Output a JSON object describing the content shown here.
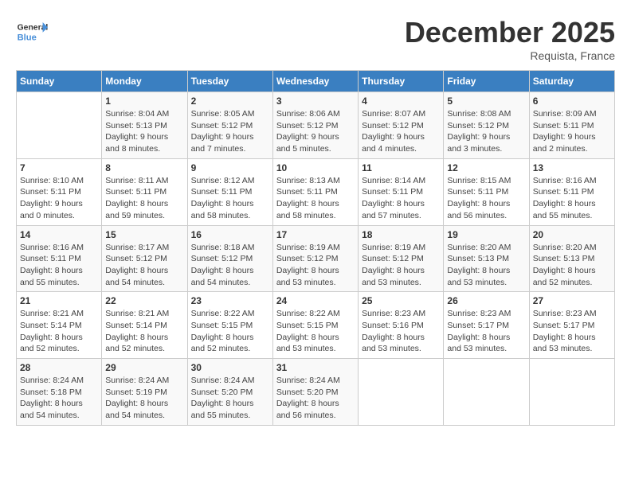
{
  "header": {
    "logo_general": "General",
    "logo_blue": "Blue",
    "month": "December 2025",
    "location": "Requista, France"
  },
  "days_of_week": [
    "Sunday",
    "Monday",
    "Tuesday",
    "Wednesday",
    "Thursday",
    "Friday",
    "Saturday"
  ],
  "weeks": [
    [
      {
        "day": "",
        "info": ""
      },
      {
        "day": "1",
        "info": "Sunrise: 8:04 AM\nSunset: 5:13 PM\nDaylight: 9 hours\nand 8 minutes."
      },
      {
        "day": "2",
        "info": "Sunrise: 8:05 AM\nSunset: 5:12 PM\nDaylight: 9 hours\nand 7 minutes."
      },
      {
        "day": "3",
        "info": "Sunrise: 8:06 AM\nSunset: 5:12 PM\nDaylight: 9 hours\nand 5 minutes."
      },
      {
        "day": "4",
        "info": "Sunrise: 8:07 AM\nSunset: 5:12 PM\nDaylight: 9 hours\nand 4 minutes."
      },
      {
        "day": "5",
        "info": "Sunrise: 8:08 AM\nSunset: 5:12 PM\nDaylight: 9 hours\nand 3 minutes."
      },
      {
        "day": "6",
        "info": "Sunrise: 8:09 AM\nSunset: 5:11 PM\nDaylight: 9 hours\nand 2 minutes."
      }
    ],
    [
      {
        "day": "7",
        "info": "Sunrise: 8:10 AM\nSunset: 5:11 PM\nDaylight: 9 hours\nand 0 minutes."
      },
      {
        "day": "8",
        "info": "Sunrise: 8:11 AM\nSunset: 5:11 PM\nDaylight: 8 hours\nand 59 minutes."
      },
      {
        "day": "9",
        "info": "Sunrise: 8:12 AM\nSunset: 5:11 PM\nDaylight: 8 hours\nand 58 minutes."
      },
      {
        "day": "10",
        "info": "Sunrise: 8:13 AM\nSunset: 5:11 PM\nDaylight: 8 hours\nand 58 minutes."
      },
      {
        "day": "11",
        "info": "Sunrise: 8:14 AM\nSunset: 5:11 PM\nDaylight: 8 hours\nand 57 minutes."
      },
      {
        "day": "12",
        "info": "Sunrise: 8:15 AM\nSunset: 5:11 PM\nDaylight: 8 hours\nand 56 minutes."
      },
      {
        "day": "13",
        "info": "Sunrise: 8:16 AM\nSunset: 5:11 PM\nDaylight: 8 hours\nand 55 minutes."
      }
    ],
    [
      {
        "day": "14",
        "info": "Sunrise: 8:16 AM\nSunset: 5:11 PM\nDaylight: 8 hours\nand 55 minutes."
      },
      {
        "day": "15",
        "info": "Sunrise: 8:17 AM\nSunset: 5:12 PM\nDaylight: 8 hours\nand 54 minutes."
      },
      {
        "day": "16",
        "info": "Sunrise: 8:18 AM\nSunset: 5:12 PM\nDaylight: 8 hours\nand 54 minutes."
      },
      {
        "day": "17",
        "info": "Sunrise: 8:19 AM\nSunset: 5:12 PM\nDaylight: 8 hours\nand 53 minutes."
      },
      {
        "day": "18",
        "info": "Sunrise: 8:19 AM\nSunset: 5:12 PM\nDaylight: 8 hours\nand 53 minutes."
      },
      {
        "day": "19",
        "info": "Sunrise: 8:20 AM\nSunset: 5:13 PM\nDaylight: 8 hours\nand 53 minutes."
      },
      {
        "day": "20",
        "info": "Sunrise: 8:20 AM\nSunset: 5:13 PM\nDaylight: 8 hours\nand 52 minutes."
      }
    ],
    [
      {
        "day": "21",
        "info": "Sunrise: 8:21 AM\nSunset: 5:14 PM\nDaylight: 8 hours\nand 52 minutes."
      },
      {
        "day": "22",
        "info": "Sunrise: 8:21 AM\nSunset: 5:14 PM\nDaylight: 8 hours\nand 52 minutes."
      },
      {
        "day": "23",
        "info": "Sunrise: 8:22 AM\nSunset: 5:15 PM\nDaylight: 8 hours\nand 52 minutes."
      },
      {
        "day": "24",
        "info": "Sunrise: 8:22 AM\nSunset: 5:15 PM\nDaylight: 8 hours\nand 53 minutes."
      },
      {
        "day": "25",
        "info": "Sunrise: 8:23 AM\nSunset: 5:16 PM\nDaylight: 8 hours\nand 53 minutes."
      },
      {
        "day": "26",
        "info": "Sunrise: 8:23 AM\nSunset: 5:17 PM\nDaylight: 8 hours\nand 53 minutes."
      },
      {
        "day": "27",
        "info": "Sunrise: 8:23 AM\nSunset: 5:17 PM\nDaylight: 8 hours\nand 53 minutes."
      }
    ],
    [
      {
        "day": "28",
        "info": "Sunrise: 8:24 AM\nSunset: 5:18 PM\nDaylight: 8 hours\nand 54 minutes."
      },
      {
        "day": "29",
        "info": "Sunrise: 8:24 AM\nSunset: 5:19 PM\nDaylight: 8 hours\nand 54 minutes."
      },
      {
        "day": "30",
        "info": "Sunrise: 8:24 AM\nSunset: 5:20 PM\nDaylight: 8 hours\nand 55 minutes."
      },
      {
        "day": "31",
        "info": "Sunrise: 8:24 AM\nSunset: 5:20 PM\nDaylight: 8 hours\nand 56 minutes."
      },
      {
        "day": "",
        "info": ""
      },
      {
        "day": "",
        "info": ""
      },
      {
        "day": "",
        "info": ""
      }
    ]
  ]
}
